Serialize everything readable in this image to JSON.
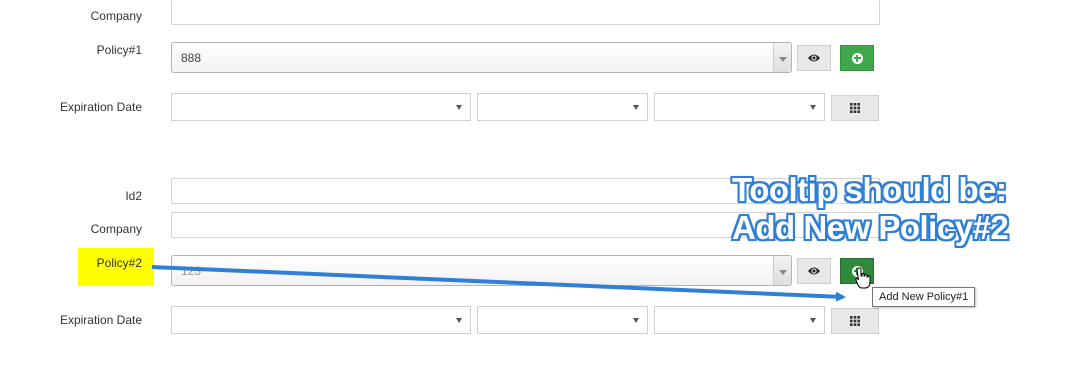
{
  "group1": {
    "company_label": "Company",
    "policy_label": "Policy#1",
    "policy_value": "888",
    "expiration_label": "Expiration Date"
  },
  "group2": {
    "id_label": "Id2",
    "company_label": "Company",
    "policy_label": "Policy#2",
    "policy_value": "123",
    "expiration_label": "Expiration Date"
  },
  "tooltip": {
    "text": "Add New Policy#1"
  },
  "annotation": {
    "line1": "Tooltip should be:",
    "line2": "Add New Policy#2"
  },
  "colors": {
    "accent_green": "#3fa84d",
    "annotation_blue": "#2f7fd6",
    "highlight_yellow": "#ffff00"
  },
  "icons": {
    "view": "eye-icon",
    "add": "plus-circle-icon",
    "calendar": "grid-calendar-icon"
  }
}
